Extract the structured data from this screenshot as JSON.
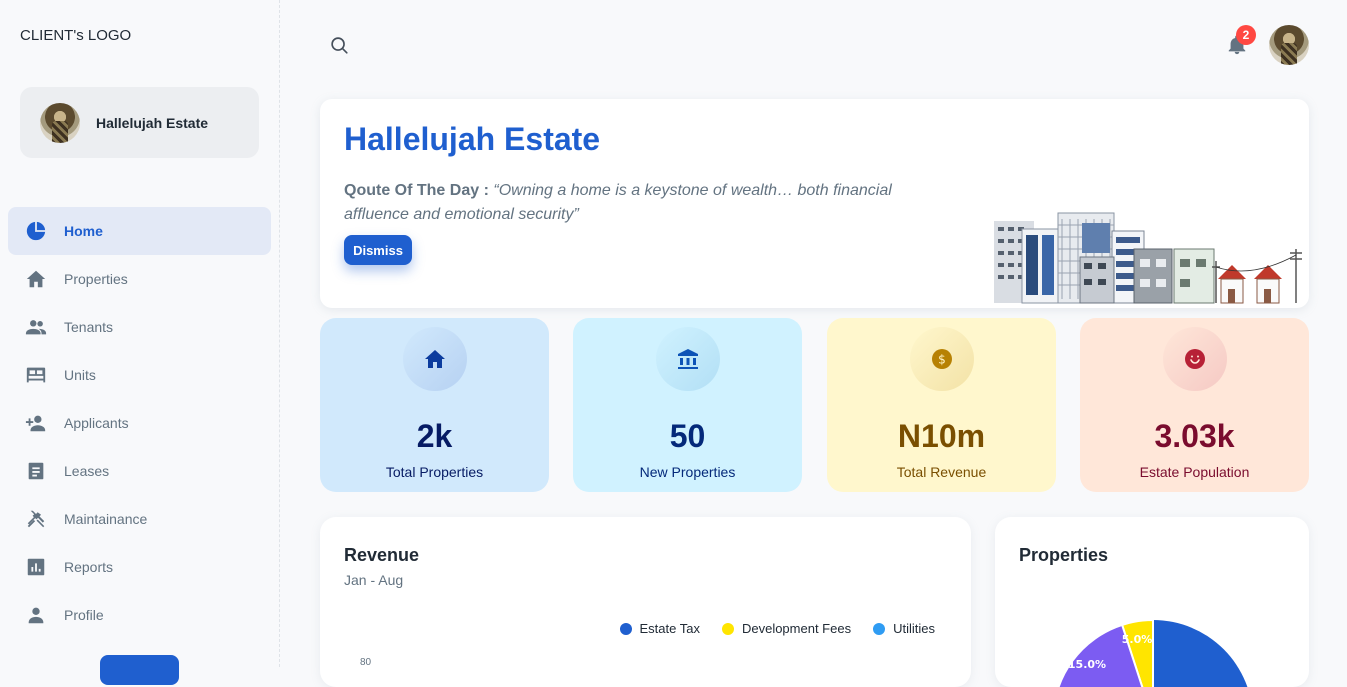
{
  "sidebar": {
    "logo": "CLIENT's LOGO",
    "account_name": "Hallelujah Estate",
    "items": [
      {
        "label": "Home",
        "icon": "pie-chart-icon",
        "active": true
      },
      {
        "label": "Properties",
        "icon": "house-icon"
      },
      {
        "label": "Tenants",
        "icon": "people-icon"
      },
      {
        "label": "Units",
        "icon": "bed-icon"
      },
      {
        "label": "Applicants",
        "icon": "person-add-icon"
      },
      {
        "label": "Leases",
        "icon": "document-icon"
      },
      {
        "label": "Maintainance",
        "icon": "tools-icon"
      },
      {
        "label": "Reports",
        "icon": "bar-chart-icon"
      },
      {
        "label": "Profile",
        "icon": "person-icon"
      }
    ]
  },
  "header": {
    "notification_count": "2"
  },
  "welcome": {
    "title": "Hallelujah Estate",
    "quote_label": "Qoute Of The Day :",
    "quote_text": "“Owning a home is a keystone of wealth… both financial affluence and emotional security”",
    "dismiss_label": "Dismiss"
  },
  "stats": [
    {
      "value": "2k",
      "label": "Total Properties",
      "icon": "house-icon",
      "bg": "#d1e9fc",
      "circle": "#b6d1f2",
      "color": "#061b64",
      "icon_color": "#0c3c9e",
      "label_color": "#061b64"
    },
    {
      "value": "50",
      "label": "New Properties",
      "icon": "bank-icon",
      "bg": "#d0f2ff",
      "circle": "#b2dff5",
      "color": "#04297a",
      "icon_color": "#0c53b7",
      "label_color": "#04297a"
    },
    {
      "value": "N10m",
      "label": "Total Revenue",
      "icon": "coin-icon",
      "bg": "#fff7cd",
      "circle": "#f3e2a6",
      "color": "#7a4f01",
      "icon_color": "#b78103",
      "label_color": "#7a4f01"
    },
    {
      "value": "3.03k",
      "label": "Estate Population",
      "icon": "smile-icon",
      "bg": "#ffe7d9",
      "circle": "#f5c9c4",
      "color": "#7a0c2e",
      "icon_color": "#b72136",
      "label_color": "#7a0c2e"
    }
  ],
  "revenue": {
    "title": "Revenue",
    "subtitle": "Jan - Aug",
    "legend": [
      {
        "label": "Estate Tax",
        "color": "#1f5fcf"
      },
      {
        "label": "Development Fees",
        "color": "#ffe500"
      },
      {
        "label": "Utilities",
        "color": "#2f9cf3"
      }
    ],
    "y_top_tick": "80"
  },
  "properties": {
    "title": "Properties",
    "slice_labels": [
      "5.0%",
      "15.0%"
    ]
  }
}
